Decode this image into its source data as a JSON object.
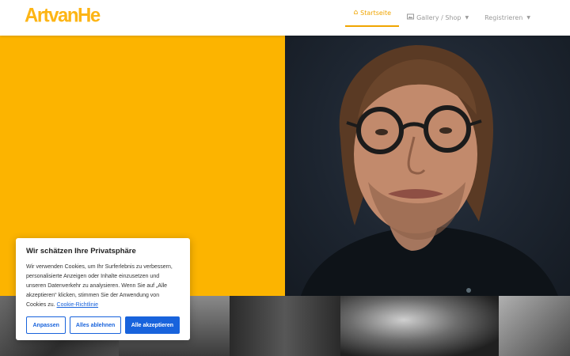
{
  "header": {
    "logo_text": "ArtvanHe",
    "nav": [
      {
        "label": "Startseite",
        "icon": "home-icon"
      },
      {
        "label": "Gallery / Shop",
        "icon": "gallery-icon"
      },
      {
        "label": "Registrieren",
        "icon": ""
      }
    ]
  },
  "cookie": {
    "title": "Wir schätzen Ihre Privatsphäre",
    "text": "Wir verwenden Cookies, um Ihr Surferlebnis zu verbessern, personalisierte Anzeigen oder Inhalte einzusetzen und unseren Datenverkehr zu analysieren. Wenn Sie auf „Alle akzeptieren“ klicken, stimmen Sie der Anwendung von Cookies zu.",
    "link_label": "Cookie-Richtlinie",
    "buttons": {
      "customize": "Anpassen",
      "reject": "Alles ablehnen",
      "accept": "Alle akzeptieren"
    }
  },
  "colors": {
    "brand": "#fdb515",
    "accent": "#f0a500",
    "hero_yellow": "#fcb400",
    "button_blue": "#1863dc"
  }
}
